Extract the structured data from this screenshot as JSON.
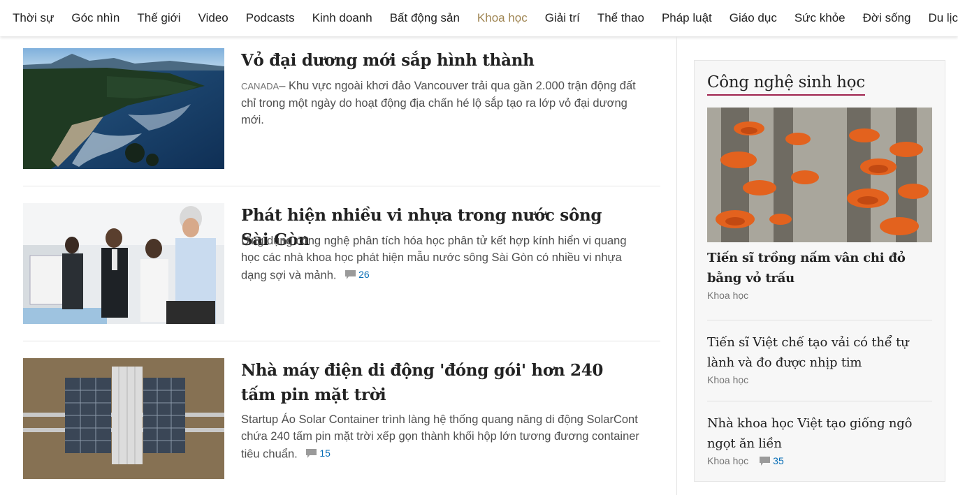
{
  "nav": {
    "items": [
      "Thời sự",
      "Góc nhìn",
      "Thế giới",
      "Video",
      "Podcasts",
      "Kinh doanh",
      "Bất động sản",
      "Khoa học",
      "Giải trí",
      "Thể thao",
      "Pháp luật",
      "Giáo dục",
      "Sức khỏe",
      "Đời sống",
      "Du lịch"
    ],
    "active": "Khoa học",
    "active_color": "#9f8552"
  },
  "articles": [
    {
      "title": "Vỏ đại dương mới sắp hình thành",
      "location": "CANADA",
      "location_sep": "–",
      "description": "Khu vực ngoài khơi đảo Vancouver trải qua gần 2.000 trận động đất chỉ trong một ngày do hoạt động địa chấn hé lộ sắp tạo ra lớp vỏ đại dương mới.",
      "image": "coastline-aerial-photo"
    },
    {
      "title": "Phát hiện nhiều vi nhựa trong nước sông Sài Gòn",
      "description": "Ứng dụng công nghệ phân tích hóa học phân tử kết hợp kính hiển vi quang học các nhà khoa học phát hiện mẫu nước sông Sài Gòn có nhiều vi nhựa dạng sợi và mảnh.",
      "comments": "26",
      "image": "lab-visit-photo"
    },
    {
      "title": "Nhà máy điện di động 'đóng gói' hơn 240 tấm pin mặt trời",
      "description": "Startup Áo Solar Container trình làng hệ thống quang năng di động SolarCont chứa 240 tấm pin mặt trời xếp gọn thành khối hộp lớn tương đương container tiêu chuẩn.",
      "comments": "15",
      "image": "solar-container-aerial-photo"
    }
  ],
  "sidebar": {
    "heading": "Công nghệ sinh học",
    "hero_image": "mushroom-farm-photo",
    "items": [
      {
        "title": "Tiến sĩ trồng nấm vân chi đỏ bằng vỏ trấu",
        "category": "Khoa học",
        "bold": true
      },
      {
        "title": "Tiến sĩ Việt chế tạo vải có thể tự lành và đo được nhịp tim",
        "category": "Khoa học"
      },
      {
        "title": "Nhà khoa học Việt tạo giống ngô ngọt ăn liền",
        "category": "Khoa học",
        "comments": "35"
      }
    ]
  },
  "colors": {
    "accent_underline": "#9f224e",
    "comment_link": "#076db6"
  }
}
